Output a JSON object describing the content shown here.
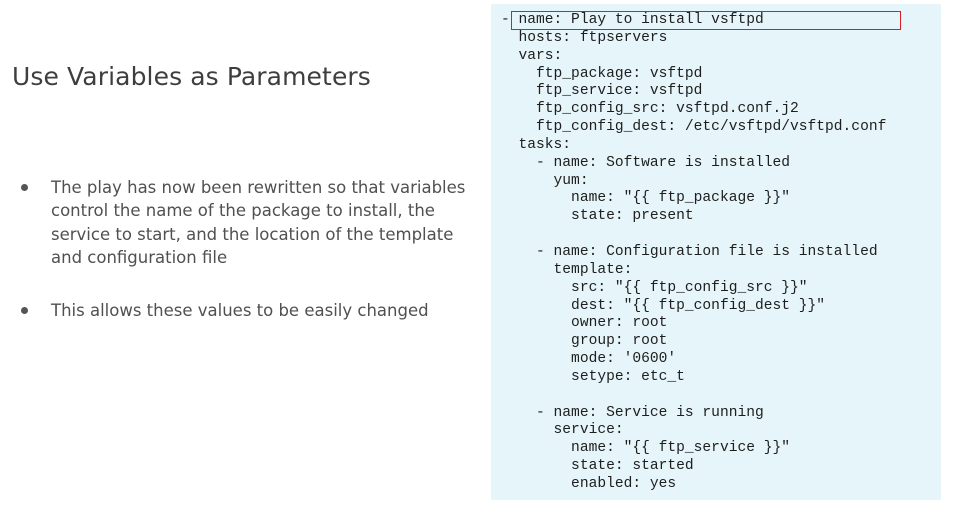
{
  "slide": {
    "title": "Use Variables as Parameters",
    "bullets": [
      "The play has now been rewritten so that variables control the name of the package to install, the service to start, and the location of the template and configuration file",
      "This allows these values to be easily changed"
    ]
  },
  "code": {
    "lines": [
      "- name: Play to install vsftpd",
      "  hosts: ftpservers",
      "  vars:",
      "    ftp_package: vsftpd",
      "    ftp_service: vsftpd",
      "    ftp_config_src: vsftpd.conf.j2",
      "    ftp_config_dest: /etc/vsftpd/vsftpd.conf",
      "  tasks:",
      "    - name: Software is installed",
      "      yum:",
      "        name: \"{{ ftp_package }}\"",
      "        state: present",
      "",
      "    - name: Configuration file is installed",
      "      template:",
      "        src: \"{{ ftp_config_src }}\"",
      "        dest: \"{{ ftp_config_dest }}\"",
      "        owner: root",
      "        group: root",
      "        mode: '0600'",
      "        setype: etc_t",
      "",
      "    - name: Service is running",
      "      service:",
      "        name: \"{{ ftp_service }}\"",
      "        state: started",
      "        enabled: yes"
    ],
    "highlight_color": "#d21f2b",
    "panel_color": "#e5f5f9"
  }
}
